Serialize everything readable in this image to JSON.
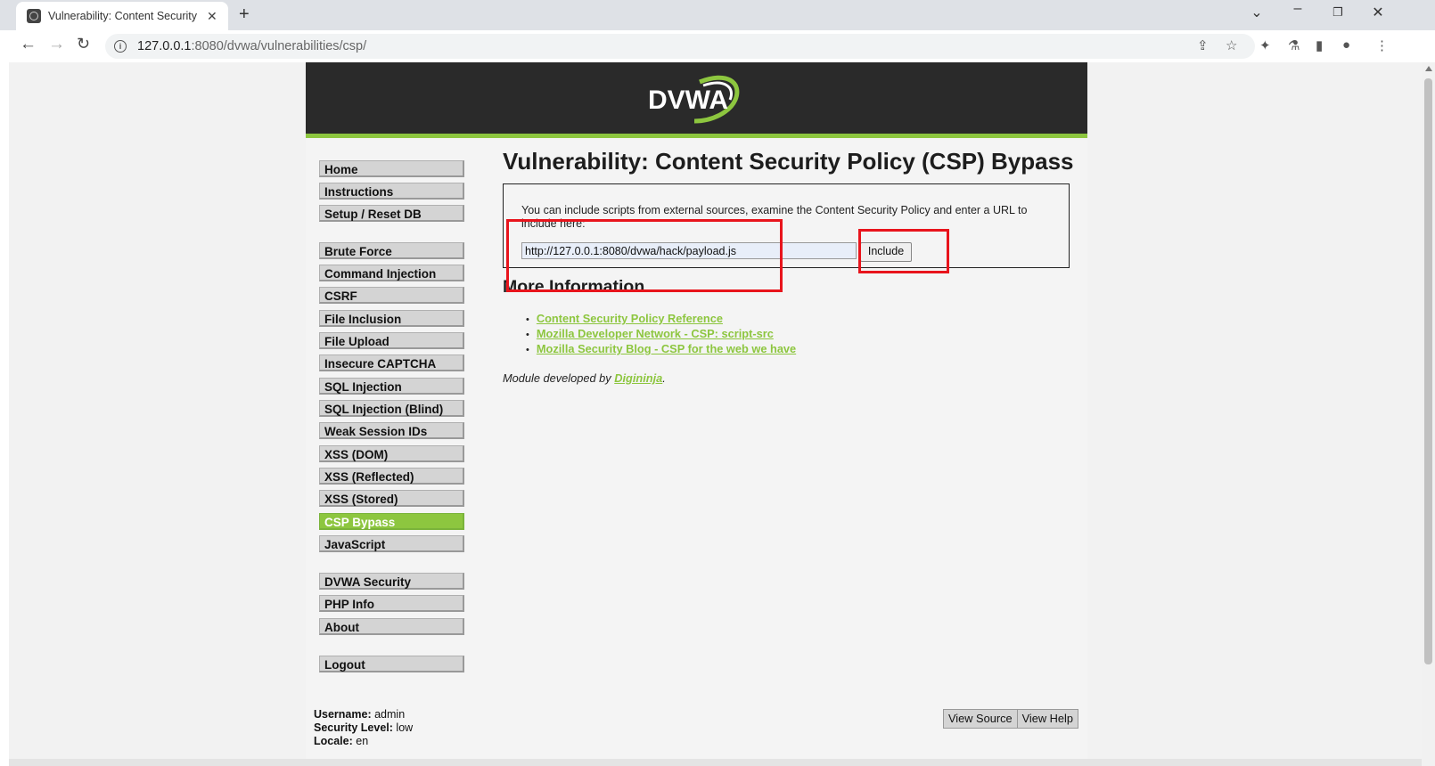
{
  "browser": {
    "tab_title": "Vulnerability: Content Security",
    "new_tab": "+",
    "url_host": "127.0.0.1",
    "url_path": ":8080/dvwa/vulnerabilities/csp/",
    "icons": [
      "back-icon",
      "forward-icon",
      "reload-icon",
      "site-info-icon",
      "share-icon",
      "bookmark-star-icon",
      "extensions-icon",
      "lab-icon",
      "side-panel-icon",
      "profile-icon",
      "menu-icon",
      "minimize-icon",
      "restore-icon",
      "close-icon"
    ]
  },
  "site": {
    "logo_text": "DVWA",
    "accent": "#8dc63f",
    "header_bg": "#2a2a2a"
  },
  "menu": {
    "group1": [
      "Home",
      "Instructions",
      "Setup / Reset DB"
    ],
    "group2": [
      "Brute Force",
      "Command Injection",
      "CSRF",
      "File Inclusion",
      "File Upload",
      "Insecure CAPTCHA",
      "SQL Injection",
      "SQL Injection (Blind)",
      "Weak Session IDs",
      "XSS (DOM)",
      "XSS (Reflected)",
      "XSS (Stored)",
      "CSP Bypass",
      "JavaScript"
    ],
    "group3": [
      "DVWA Security",
      "PHP Info",
      "About"
    ],
    "group4": [
      "Logout"
    ],
    "active": "CSP Bypass"
  },
  "main": {
    "title": "Vulnerability: Content Security Policy (CSP) Bypass",
    "description": "You can include scripts from external sources, examine the Content Security Policy and enter a URL to include here:",
    "input_value": "http://127.0.0.1:8080/dvwa/hack/payload.js",
    "include_button": "Include",
    "more_info_heading": "More Information",
    "links": [
      "Content Security Policy Reference",
      "Mozilla Developer Network - CSP: script-src",
      "Mozilla Security Blog - CSP for the web we have"
    ],
    "module_prefix": "Module developed by ",
    "module_author": "Digininja",
    "module_suffix": "."
  },
  "footer": {
    "username_label": "Username:",
    "username": "admin",
    "security_label": "Security Level:",
    "security": "low",
    "locale_label": "Locale:",
    "locale": "en",
    "view_source": "View Source",
    "view_help": "View Help"
  }
}
